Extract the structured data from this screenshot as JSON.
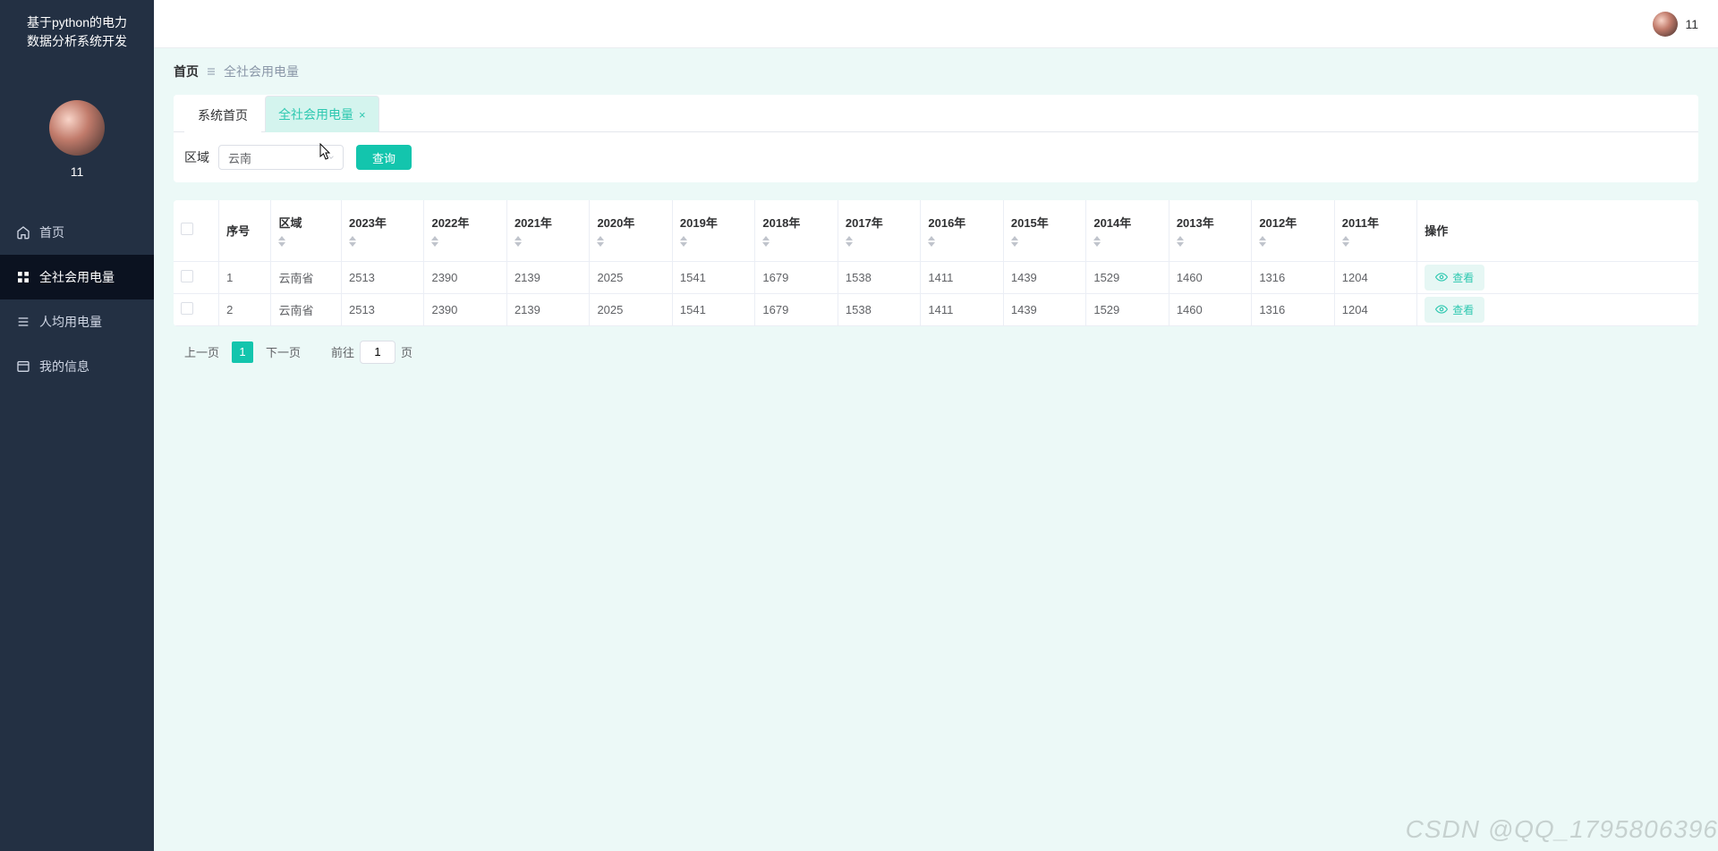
{
  "app": {
    "title_l1": "基于python的电力",
    "title_l2": "数据分析系统开发",
    "username": "11"
  },
  "topbar": {
    "username": "11"
  },
  "nav": {
    "items": [
      {
        "key": "home",
        "label": "首页"
      },
      {
        "key": "all-power",
        "label": "全社会用电量"
      },
      {
        "key": "per-capita",
        "label": "人均用电量"
      },
      {
        "key": "my-info",
        "label": "我的信息"
      }
    ]
  },
  "breadcrumb": {
    "home": "首页",
    "current": "全社会用电量"
  },
  "tabs": [
    {
      "key": "sys-home",
      "label": "系统首页",
      "closable": false
    },
    {
      "key": "all-power",
      "label": "全社会用电量",
      "closable": true
    }
  ],
  "filter": {
    "label": "区域",
    "value": "云南",
    "query_button": "查询"
  },
  "table": {
    "action_header": "操作",
    "view_label": "查看",
    "columns": {
      "index": "序号",
      "region": "区域",
      "y2023": "2023年",
      "y2022": "2022年",
      "y2021": "2021年",
      "y2020": "2020年",
      "y2019": "2019年",
      "y2018": "2018年",
      "y2017": "2017年",
      "y2016": "2016年",
      "y2015": "2015年",
      "y2014": "2014年",
      "y2013": "2013年",
      "y2012": "2012年",
      "y2011": "2011年"
    },
    "rows": [
      {
        "idx": "1",
        "region": "云南省",
        "y2023": "2513",
        "y2022": "2390",
        "y2021": "2139",
        "y2020": "2025",
        "y2019": "1541",
        "y2018": "1679",
        "y2017": "1538",
        "y2016": "1411",
        "y2015": "1439",
        "y2014": "1529",
        "y2013": "1460",
        "y2012": "1316",
        "y2011": "1204"
      },
      {
        "idx": "2",
        "region": "云南省",
        "y2023": "2513",
        "y2022": "2390",
        "y2021": "2139",
        "y2020": "2025",
        "y2019": "1541",
        "y2018": "1679",
        "y2017": "1538",
        "y2016": "1411",
        "y2015": "1439",
        "y2014": "1529",
        "y2013": "1460",
        "y2012": "1316",
        "y2011": "1204"
      }
    ]
  },
  "pagination": {
    "prev": "上一页",
    "next": "下一页",
    "current": "1",
    "goto_prefix": "前往",
    "goto_value": "1",
    "goto_suffix": "页"
  },
  "watermark": "CSDN @QQ_1795806396"
}
